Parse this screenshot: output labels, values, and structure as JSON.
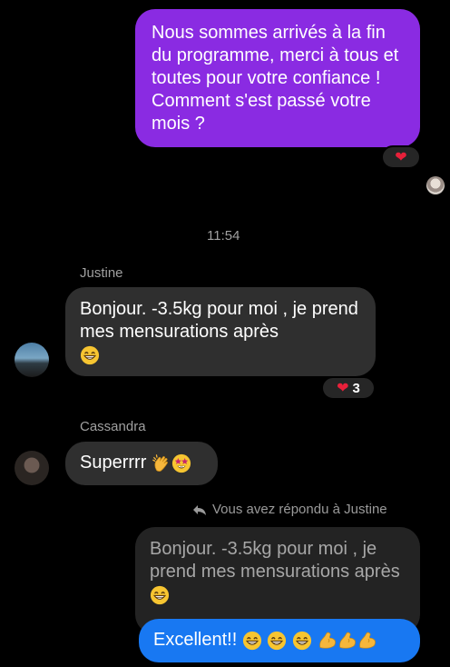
{
  "messages": {
    "sent1": "Nous sommes arrivés à la fin du programme, merci à tous et toutes pour votre confiance ! Comment s'est passé votre mois ?",
    "timestamp": "11:54",
    "justine_name": "Justine",
    "justine_msg": "Bonjour.  -3.5kg pour moi , je prend mes mensurations après",
    "justine_reaction_count": "3",
    "cassandra_name": "Cassandra",
    "cassandra_msg": "Superrrr",
    "reply_header": "Vous avez répondu à Justine",
    "quoted_msg": "Bonjour.  -3.5kg pour moi , je prend mes mensurations après",
    "reply_msg": "Excellent!!"
  },
  "icons": [
    "heart-icon",
    "grin-emoji-icon",
    "clap-emoji-icon",
    "star-eyes-emoji-icon",
    "reply-arrow-icon",
    "flex-emoji-icon"
  ],
  "colors": {
    "sent_bubble": "#8a2be2",
    "received_bubble": "#2f2f2f",
    "reply_bubble": "#1878f2",
    "heart": "#e8203a"
  }
}
